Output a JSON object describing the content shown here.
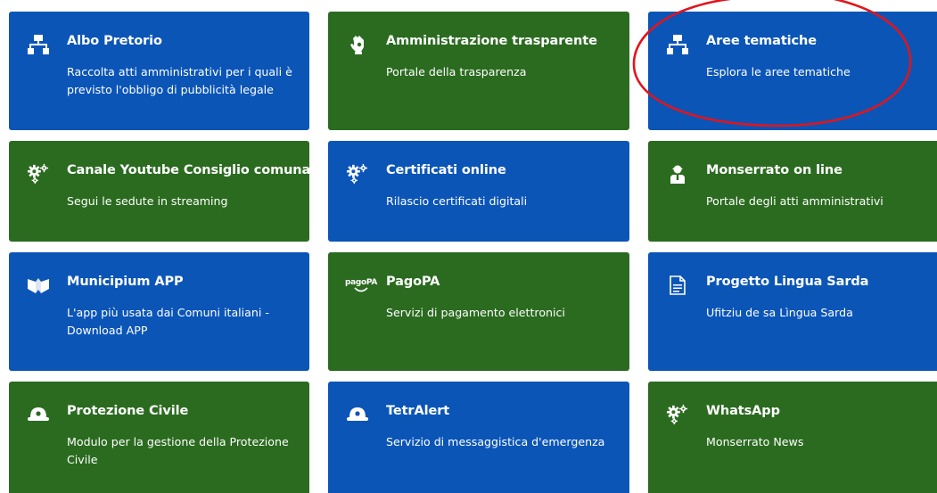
{
  "colors": {
    "blue": "#0b55b7",
    "green": "#2b6b20",
    "annotation_red": "#e0151c"
  },
  "tiles": [
    {
      "title": "Albo Pretorio",
      "desc": "Raccolta atti amministrativi per i quali è previsto l'obbligo di pubblicità legale",
      "icon": "sitemap-icon",
      "color": "blue"
    },
    {
      "title": "Amministrazione trasparente",
      "desc": "Portale della trasparenza",
      "icon": "hand-icon",
      "color": "green"
    },
    {
      "title": "Aree tematiche",
      "desc": "Esplora le aree tematiche",
      "icon": "sitemap-icon",
      "color": "blue"
    },
    {
      "title": "Canale Youtube Consiglio comunale",
      "desc": "Segui le sedute in streaming",
      "icon": "gears-icon",
      "color": "green"
    },
    {
      "title": "Certificati online",
      "desc": "Rilascio certificati digitali",
      "icon": "gears-icon",
      "color": "blue"
    },
    {
      "title": "Monserrato on line",
      "desc": "Portale degli atti amministrativi",
      "icon": "person-icon",
      "color": "green"
    },
    {
      "title": "Municipium APP",
      "desc": "L'app più usata dai Comuni italiani - Download APP",
      "icon": "municipium-icon",
      "color": "blue"
    },
    {
      "title": "PagoPA",
      "desc": "Servizi di pagamento elettronici",
      "icon": "pagopa-icon",
      "icon_text": "pagoPA",
      "color": "green"
    },
    {
      "title": "Progetto Lingua Sarda",
      "desc": "Ufitziu de sa Lìngua Sarda",
      "icon": "document-icon",
      "color": "blue"
    },
    {
      "title": "Protezione Civile",
      "desc": "Modulo per la gestione della Protezione Civile",
      "icon": "helmet-icon",
      "color": "green"
    },
    {
      "title": "TetrAlert",
      "desc": "Servizio di messaggistica d'emergenza",
      "icon": "helmet-icon",
      "color": "blue"
    },
    {
      "title": "WhatsApp",
      "desc": "Monserrato News",
      "icon": "gears-icon",
      "color": "green"
    }
  ]
}
